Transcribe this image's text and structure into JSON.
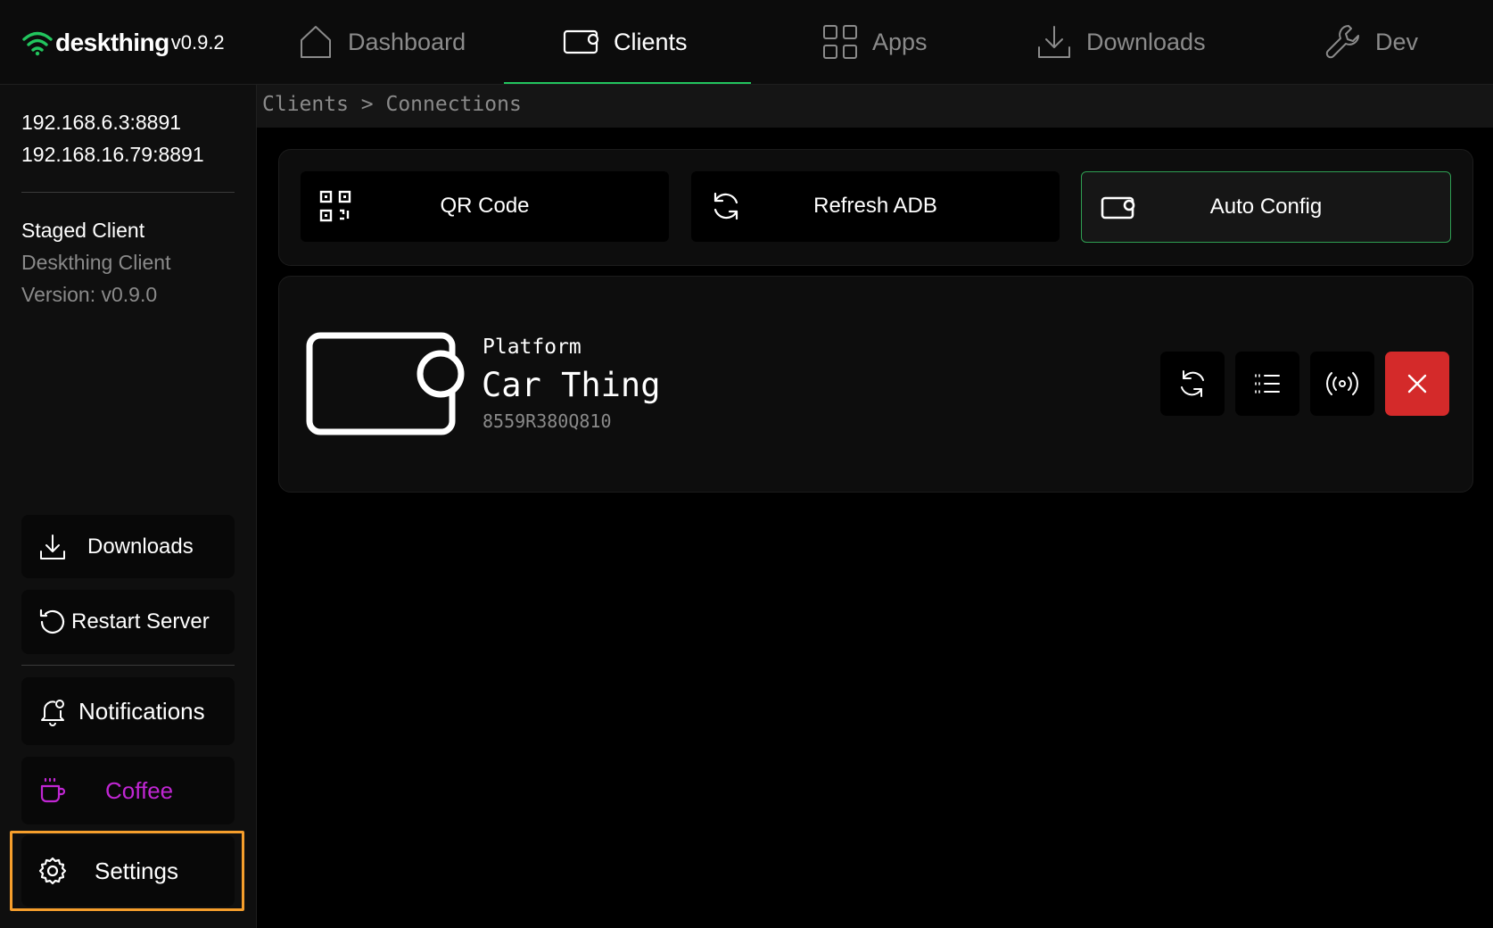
{
  "app": {
    "name": "deskthing",
    "version": "v0.9.2",
    "accent": "#22c55e"
  },
  "nav": {
    "dashboard": "Dashboard",
    "clients": "Clients",
    "apps": "Apps",
    "downloads": "Downloads",
    "dev": "Dev",
    "active": "Clients"
  },
  "sidebar": {
    "ips": [
      "192.168.6.3:8891",
      "192.168.16.79:8891"
    ],
    "staged": {
      "title": "Staged Client",
      "name": "Deskthing Client",
      "version": "Version: v0.9.0"
    },
    "buttons": {
      "downloads": "Downloads",
      "restart": "Restart Server",
      "notifications": "Notifications",
      "coffee": "Coffee",
      "settings": "Settings"
    },
    "coffee_color": "#c026d3"
  },
  "breadcrumb": "Clients > Connections",
  "actions": {
    "qr": "QR Code",
    "refresh": "Refresh ADB",
    "autoconfig": "Auto Config"
  },
  "device": {
    "platform": "Platform",
    "name": "Car Thing",
    "serial": "8559R380Q810",
    "disconnect_color": "#d42a2a"
  },
  "highlight_color": "#f59e2c"
}
